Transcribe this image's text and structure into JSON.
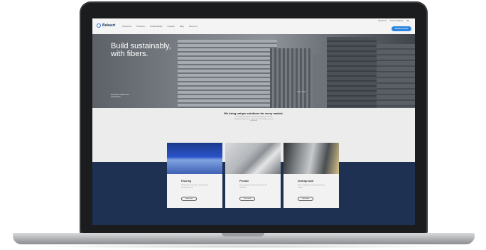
{
  "site": {
    "logo": "Bekaert",
    "nav": [
      "Industries",
      "Products",
      "Sustainability",
      "Insights",
      "Blog",
      "About us"
    ],
    "utility": [
      "Contact us",
      "Find a distributor",
      "EN"
    ],
    "cta": "Request a quote"
  },
  "hero": {
    "title_line1": "Build sustainably,",
    "title_line2": "with fibers.",
    "caption": "Steel fiber solutions for construction",
    "link": "Learn more"
  },
  "intro": {
    "title": "We bring unique solutions for every market.",
    "text": "Our steel fibers reinforce concrete for flooring, precast and underground applications, helping you build stronger and more sustainably."
  },
  "cards": [
    {
      "title": "Flooring",
      "text": "Jointless floors with fewer cracks and lower maintenance costs.",
      "button": "Learn more"
    },
    {
      "title": "Precast",
      "text": "Faster production and thinner elements with steel fibers.",
      "button": "Learn more"
    },
    {
      "title": "Underground",
      "text": "Safe and durable tunnel linings and mining support.",
      "button": "Learn more"
    }
  ]
}
